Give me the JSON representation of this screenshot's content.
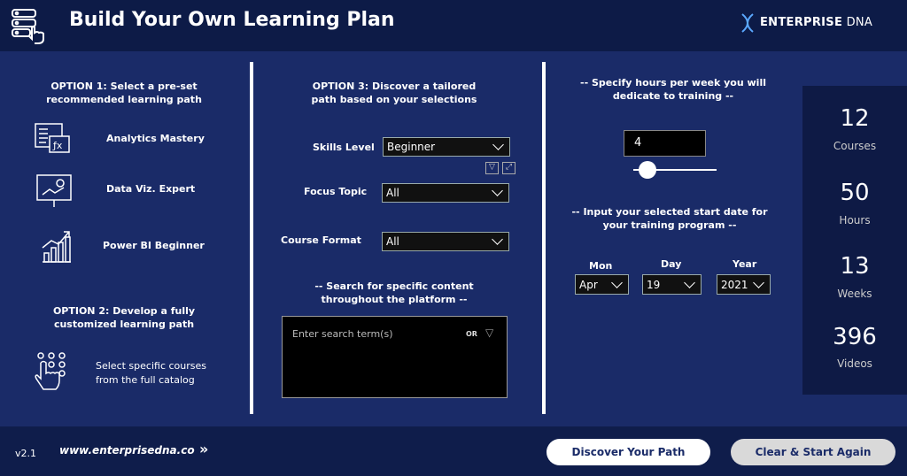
{
  "header": {
    "title": "Build Your Own Learning Plan",
    "brand_bold": "ENTERPRISE",
    "brand_light": " DNA"
  },
  "option1": {
    "heading": "OPTION 1: Select a pre-set recommended learning path",
    "paths": [
      {
        "label": "Analytics Mastery",
        "icon": "formula-icon"
      },
      {
        "label": "Data Viz. Expert",
        "icon": "chart-board-icon"
      },
      {
        "label": "Power BI Beginner",
        "icon": "bar-growth-icon"
      }
    ]
  },
  "option2": {
    "heading": "OPTION 2: Develop a fully customized learning path",
    "text": "Select specific courses from the full catalog"
  },
  "option3": {
    "heading": "OPTION 3: Discover a tailored path based on your selections",
    "skills_label": "Skills Level",
    "skills_value": "Beginner",
    "focus_label": "Focus Topic",
    "focus_value": "All",
    "format_label": "Course Format",
    "format_value": "All"
  },
  "search": {
    "heading": "-- Search for specific content throughout the platform  --",
    "placeholder": "Enter search term(s)",
    "or_label": "OR"
  },
  "hours": {
    "heading": "-- Specify hours per week you will dedicate to training --",
    "value": "4",
    "slider_fraction": 0.1
  },
  "start_date": {
    "heading": "-- Input your selected start date for your training program --",
    "mon_label": "Mon",
    "mon_value": "Apr",
    "day_label": "Day",
    "day_value": "19",
    "year_label": "Year",
    "year_value": "2021"
  },
  "stats": [
    {
      "value": "12",
      "unit": "Courses"
    },
    {
      "value": "50",
      "unit": "Hours"
    },
    {
      "value": "13",
      "unit": "Weeks"
    },
    {
      "value": "396",
      "unit": "Videos"
    }
  ],
  "footer": {
    "version": "v2.1",
    "url": "www.enterprisedna.co",
    "discover_label": "Discover Your Path",
    "clear_label": "Clear & Start Again"
  }
}
